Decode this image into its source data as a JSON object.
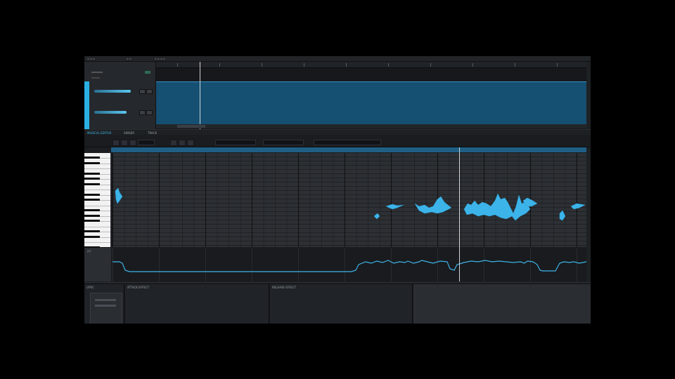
{
  "app": {
    "accent": "#2bb0e6",
    "region_color": "#154f72",
    "note_color": "#3cb4ea"
  },
  "editor": {
    "tabs": [
      {
        "label": "MUSICAL EDITOR",
        "active": true
      },
      {
        "label": "SINGER",
        "active": false
      },
      {
        "label": "TRACK",
        "active": false
      }
    ],
    "parameter_lane": "PIT"
  },
  "panels": {
    "note": "LYRIC",
    "attack": "ATTACK EFFECT",
    "release": "RELEASE EFFECT"
  },
  "icons": {
    "pencil": "pencil-icon",
    "select": "pointer-icon",
    "eraser": "eraser-icon",
    "zoom": "zoom-icon",
    "play": "play-icon",
    "stop": "stop-icon"
  }
}
